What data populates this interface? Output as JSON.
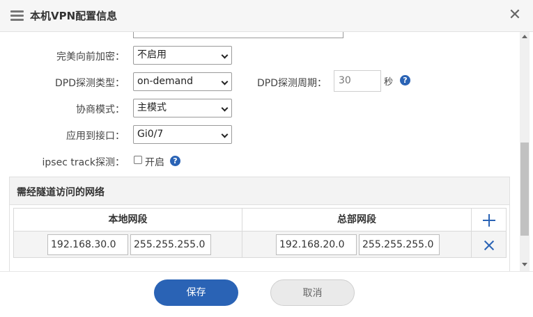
{
  "header": {
    "title": "本机VPN配置信息"
  },
  "form": {
    "pfs": {
      "label": "完美向前加密：",
      "value": "不启用"
    },
    "dpd_type": {
      "label": "DPD探测类型：",
      "value": "on-demand"
    },
    "dpd_period": {
      "label": "DPD探测周期：",
      "value": "30",
      "unit": "秒"
    },
    "negotiation": {
      "label": "协商模式：",
      "value": "主模式"
    },
    "interface": {
      "label": "应用到接口：",
      "value": "Gi0/7"
    },
    "ipsec_track": {
      "label": "ipsec track探测：",
      "checkbox_label": "开启",
      "checked": false
    }
  },
  "network": {
    "title": "需经隧道访问的网络",
    "columns": {
      "local": "本地网段",
      "remote": "总部网段"
    },
    "rows": [
      {
        "local_ip": "192.168.30.0",
        "local_mask": "255.255.255.0",
        "remote_ip": "192.168.20.0",
        "remote_mask": "255.255.255.0"
      }
    ]
  },
  "buttons": {
    "save": "保存",
    "cancel": "取消"
  },
  "colors": {
    "accent": "#2a63b5"
  },
  "icons": {
    "menu": "menu-icon",
    "close": "close-icon",
    "help": "help-icon",
    "add": "add-icon",
    "delete": "delete-icon"
  }
}
